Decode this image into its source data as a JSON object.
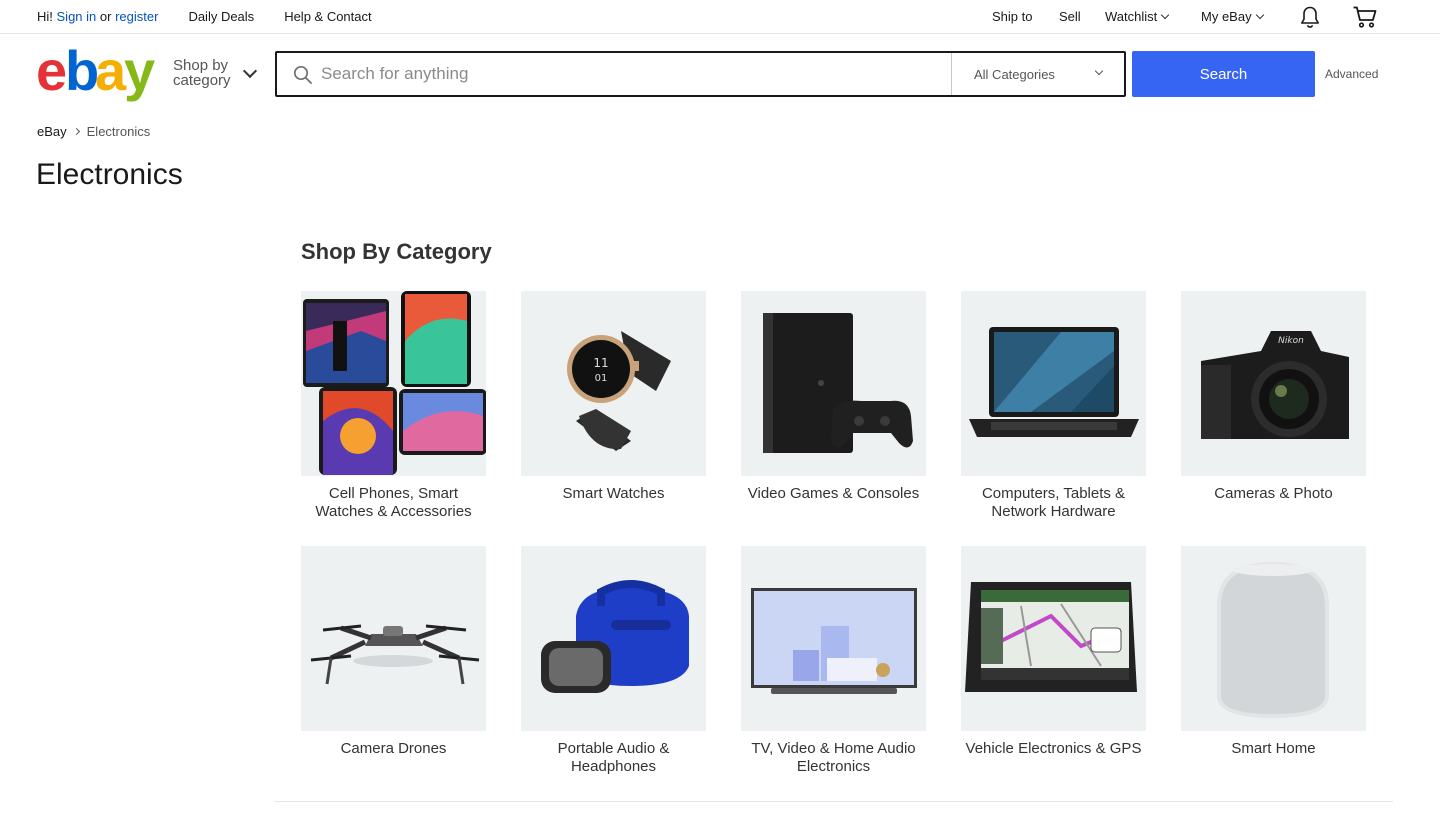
{
  "topbar": {
    "greeting": "Hi!",
    "sign_in": "Sign in",
    "or": "or",
    "register": "register",
    "daily_deals": "Daily Deals",
    "help_contact": "Help & Contact",
    "ship_to": "Ship to",
    "sell": "Sell",
    "watchlist": "Watchlist",
    "my_ebay": "My eBay",
    "icons": [
      "bell-icon",
      "cart-icon"
    ]
  },
  "header": {
    "logo_colors": {
      "e": "#e53238",
      "b": "#0064d2",
      "a": "#f5af02",
      "y": "#86b817"
    },
    "shop_by_line1": "Shop by",
    "shop_by_line2": "category",
    "search_placeholder": "Search for anything",
    "category_select": "All Categories",
    "search_button": "Search",
    "advanced": "Advanced",
    "accent": "#3665f3"
  },
  "breadcrumb": {
    "home": "eBay",
    "current": "Electronics"
  },
  "page": {
    "title": "Electronics",
    "section_title": "Shop By Category"
  },
  "categories": [
    {
      "label": "Cell Phones, Smart Watches & Accessories",
      "icon": "phones-image"
    },
    {
      "label": "Smart Watches",
      "icon": "watch-image"
    },
    {
      "label": "Video Games & Consoles",
      "icon": "console-image"
    },
    {
      "label": "Computers, Tablets & Network Hardware",
      "icon": "laptop-image"
    },
    {
      "label": "Cameras & Photo",
      "icon": "camera-image"
    },
    {
      "label": "Camera Drones",
      "icon": "drone-image"
    },
    {
      "label": "Portable Audio & Headphones",
      "icon": "speaker-image"
    },
    {
      "label": "TV, Video & Home Audio Electronics",
      "icon": "tv-image"
    },
    {
      "label": "Vehicle Electronics & GPS",
      "icon": "gps-image"
    },
    {
      "label": "Smart Home",
      "icon": "smart-speaker-image"
    }
  ]
}
